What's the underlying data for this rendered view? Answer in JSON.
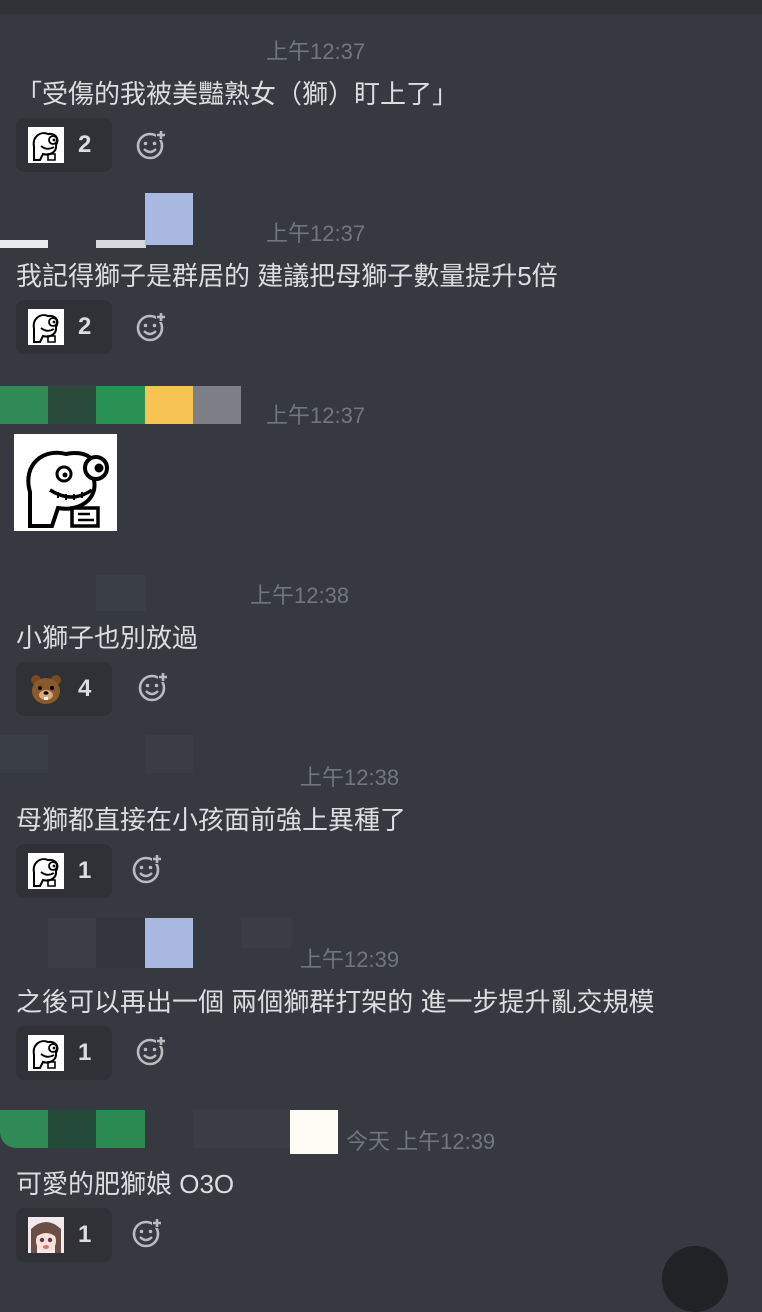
{
  "messages": [
    {
      "time": "上午12:37",
      "text": "「受傷的我被美豔熟女（獅）盯上了」",
      "reaction": {
        "icon": "rage-face-sticker-icon",
        "count": "2"
      }
    },
    {
      "time": "上午12:37",
      "text": "我記得獅子是群居的 建議把母獅子數量提升5倍",
      "reaction": {
        "icon": "rage-face-sticker-icon",
        "count": "2"
      }
    },
    {
      "time": "上午12:37",
      "sticker": "rage-face-sticker-icon"
    },
    {
      "time": "上午12:38",
      "text": "小獅子也別放過",
      "reaction": {
        "icon": "bear-sticker-icon",
        "count": "4"
      }
    },
    {
      "time": "上午12:38",
      "text": "母獅都直接在小孩面前強上異種了",
      "reaction": {
        "icon": "rage-face-sticker-icon",
        "count": "1"
      }
    },
    {
      "time": "上午12:39",
      "text": "之後可以再出一個 兩個獅群打架的 進一步提升亂交規模",
      "reaction": {
        "icon": "rage-face-sticker-icon",
        "count": "1"
      }
    },
    {
      "time": "今天 上午12:39",
      "text": "可愛的肥獅娘 O3O",
      "reaction": {
        "icon": "anime-girl-sticker-icon",
        "count": "1"
      }
    }
  ],
  "colors": {
    "background": "#36393f",
    "reaction_bg": "#2f3136",
    "timestamp": "#72767d",
    "text": "#dcddde"
  }
}
